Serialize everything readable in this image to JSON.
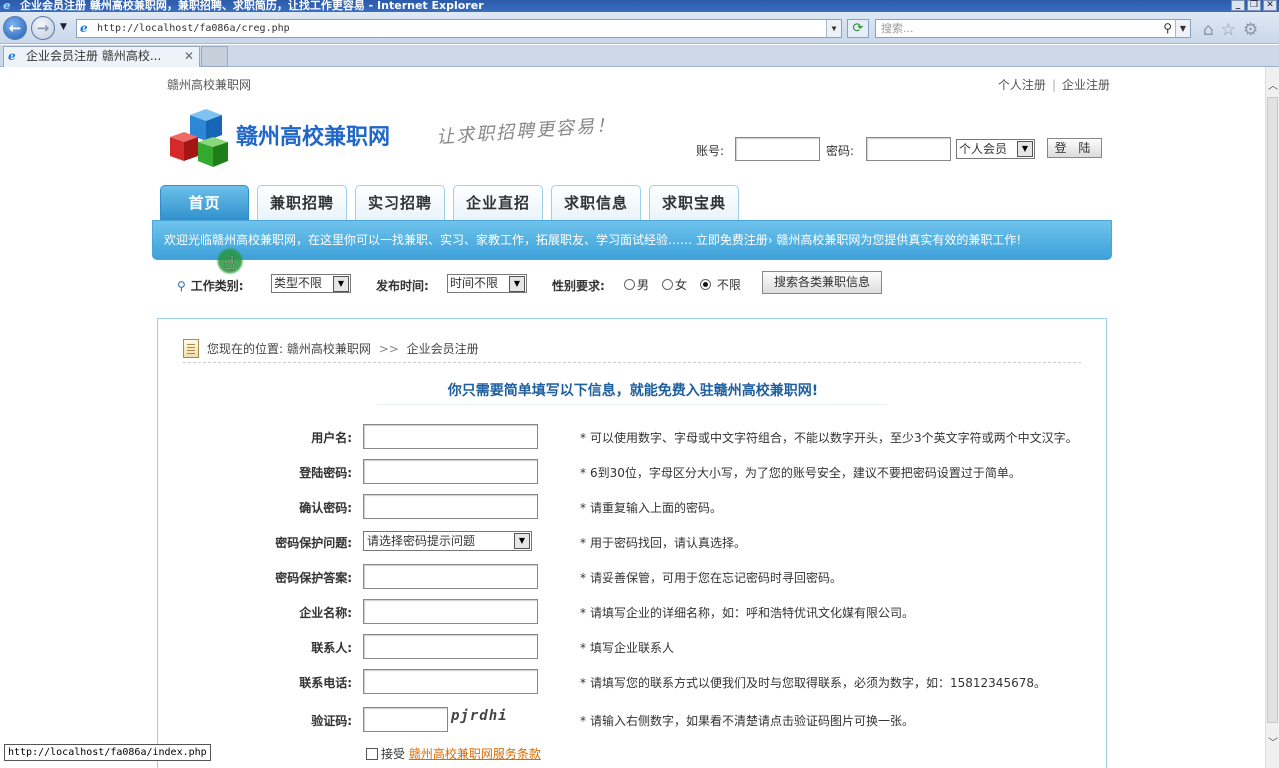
{
  "browser": {
    "title": "企业会员注册 赣州高校兼职网，兼职招聘、求职简历，让找工作更容易 - Internet Explorer",
    "url": "http://localhost/fa086a/creg.php",
    "search_placeholder": "搜索...",
    "tab_label": "企业会员注册 赣州高校...",
    "status_url": "http://localhost/fa086a/index.php"
  },
  "site": {
    "top_name": "赣州高校兼职网",
    "top_links": [
      "个人注册",
      "企业注册"
    ],
    "logo_text": "赣州高校兼职网",
    "slogan": "让求职招聘更容易！",
    "login": {
      "account_label": "账号:",
      "password_label": "密码:",
      "member_type": "个人会员",
      "login_button": "登 陆"
    },
    "nav": [
      "首页",
      "兼职招聘",
      "实习招聘",
      "企业直招",
      "求职信息",
      "求职宝典"
    ],
    "banner": "欢迎光临赣州高校兼职网，在这里你可以一找兼职、实习、家教工作，拓展职友、学习面试经验……  立即免费注册› 赣州高校兼职网为您提供真实有效的兼职工作!"
  },
  "filter": {
    "category_label": "工作类别:",
    "category_value": "类型不限",
    "time_label": "发布时间:",
    "time_value": "时间不限",
    "gender_label": "性别要求:",
    "gender_options": [
      "男",
      "女",
      "不限"
    ],
    "gender_selected": "不限",
    "search_button": "搜索各类兼职信息"
  },
  "breadcrumb": {
    "prefix": "您现在的位置:",
    "home": "赣州高校兼职网",
    "separator": ">>",
    "current": "企业会员注册"
  },
  "form": {
    "title": "你只需要简单填写以下信息，就能免费入驻赣州高校兼职网!",
    "rows": [
      {
        "label": "用户名:",
        "hint": "可以使用数字、字母或中文字符组合，不能以数字开头，至少3个英文字符或两个中文汉字。"
      },
      {
        "label": "登陆密码:",
        "hint": "6到30位，字母区分大小写，为了您的账号安全，建议不要把密码设置过于简单。"
      },
      {
        "label": "确认密码:",
        "hint": "请重复输入上面的密码。"
      },
      {
        "label": "密码保护问题:",
        "hint": "用于密码找回，请认真选择。",
        "select": "请选择密码提示问题"
      },
      {
        "label": "密码保护答案:",
        "hint": "请妥善保管，可用于您在忘记密码时寻回密码。"
      },
      {
        "label": "企业名称:",
        "hint": "请填写企业的详细名称，如：呼和浩特优讯文化媒有限公司。"
      },
      {
        "label": "联系人:",
        "hint": "填写企业联系人"
      },
      {
        "label": "联系电话:",
        "hint": "请填写您的联系方式以便我们及时与您取得联系，必须为数字，如：15812345678。"
      },
      {
        "label": "验证码:",
        "hint": "请输入右侧数字，如果看不清楚请点击验证码图片可换一张。",
        "captcha": "pjrdhi"
      }
    ],
    "star": "*",
    "agree_label": "接受",
    "agree_link": "赣州高校兼职网服务条款"
  }
}
